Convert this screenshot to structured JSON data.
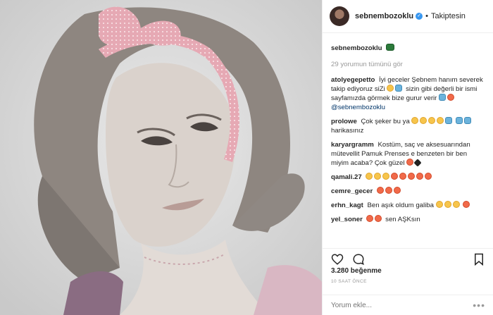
{
  "header": {
    "username": "sebnembozoklu",
    "separator": "•",
    "follow_status": "Takiptesin"
  },
  "caption": {
    "username": "sebnembozoklu"
  },
  "view_all": "29 yorumun tümünü gör",
  "comments": [
    {
      "user": "atolyegepetto",
      "text": "İyi geceler Şebnem hanım severek takip ediyoruz siZi",
      "text2": "sizin gibi değerli bir ismi sayfamızda görmek bize gurur verir",
      "mention": "@sebnembozoklu"
    },
    {
      "user": "prolowe",
      "text": "Çok şeker bu ya",
      "text2": "harikasınız"
    },
    {
      "user": "karyargramm",
      "text": "Kostüm, saç ve aksesuarından mütevellit Pamuk Prenses e benzeten bir ben miyim acaba? Çok güzel"
    },
    {
      "user": "qamali.27",
      "text": ""
    },
    {
      "user": "cemre_gecer",
      "text": ""
    },
    {
      "user": "erhn_kagt",
      "text": "Ben aşık oldum galiba"
    },
    {
      "user": "yel_soner",
      "text": "sen AŞKsın"
    }
  ],
  "likes": "3.280 beğenme",
  "timestamp": "10 SAAT ÖNCE",
  "comment_input": {
    "placeholder": "Yorum ekle..."
  },
  "more_options": "•••",
  "icons": [
    "heart-icon",
    "comment-icon",
    "bookmark-icon",
    "verified-icon",
    "more-options-icon"
  ],
  "colors": {
    "verified": "#3897f0",
    "headband": "#e8a8b4",
    "muted": "#999999",
    "text": "#262626"
  }
}
